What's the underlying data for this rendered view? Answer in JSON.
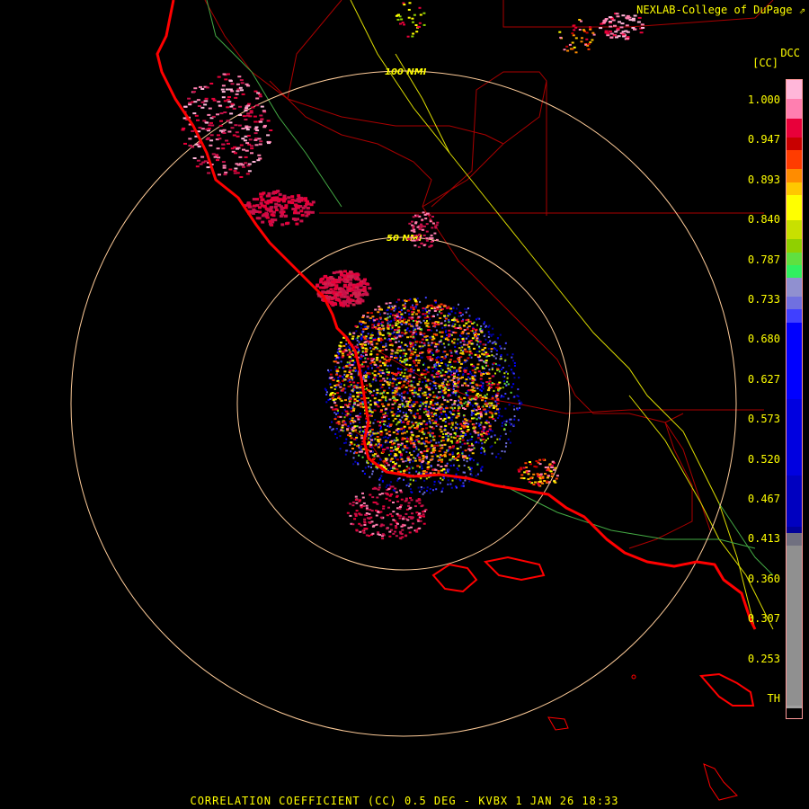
{
  "header": {
    "credit": "NEXLAB-College of DuPage",
    "credit_icon": "external-link-icon",
    "product_code": "DCC",
    "unit": "[CC]"
  },
  "footer": {
    "caption": "CORRELATION COEFFICIENT (CC) 0.5 DEG - KVBX 1 JAN 26 18:33"
  },
  "range_rings": {
    "inner_label": "50 NMI",
    "outer_label": "100 NMI"
  },
  "legend": {
    "ticks": [
      "1.000",
      "0.947",
      "0.893",
      "0.840",
      "0.787",
      "0.733",
      "0.680",
      "0.627",
      "0.573",
      "0.520",
      "0.467",
      "0.413",
      "0.360",
      "0.307",
      "0.253",
      "TH"
    ],
    "colors": [
      "#ffb6d9",
      "#ff7fb0",
      "#e8003a",
      "#c80000",
      "#ff3c00",
      "#ff8c00",
      "#ffc800",
      "#ffff00",
      "#c8e000",
      "#90d000",
      "#60e040",
      "#30f060",
      "#9090d0",
      "#7070e0",
      "#4040ff",
      "#0000ff",
      "#0000e0",
      "#0000c0",
      "#000099",
      "#707080",
      "#909090",
      "#a0a0a0",
      "#000000"
    ],
    "color_stops": [
      0.0,
      0.03,
      0.06,
      0.09,
      0.11,
      0.14,
      0.16,
      0.18,
      0.22,
      0.25,
      0.27,
      0.29,
      0.31,
      0.34,
      0.36,
      0.38,
      0.5,
      0.62,
      0.7,
      0.71,
      0.73,
      0.98,
      0.985
    ],
    "th_color": "#000000"
  },
  "colors": {
    "text": "#ffff00",
    "ring": "#ffcc99",
    "coast": "#ff0000",
    "county": "#cc0000",
    "road": "#ffff00"
  }
}
